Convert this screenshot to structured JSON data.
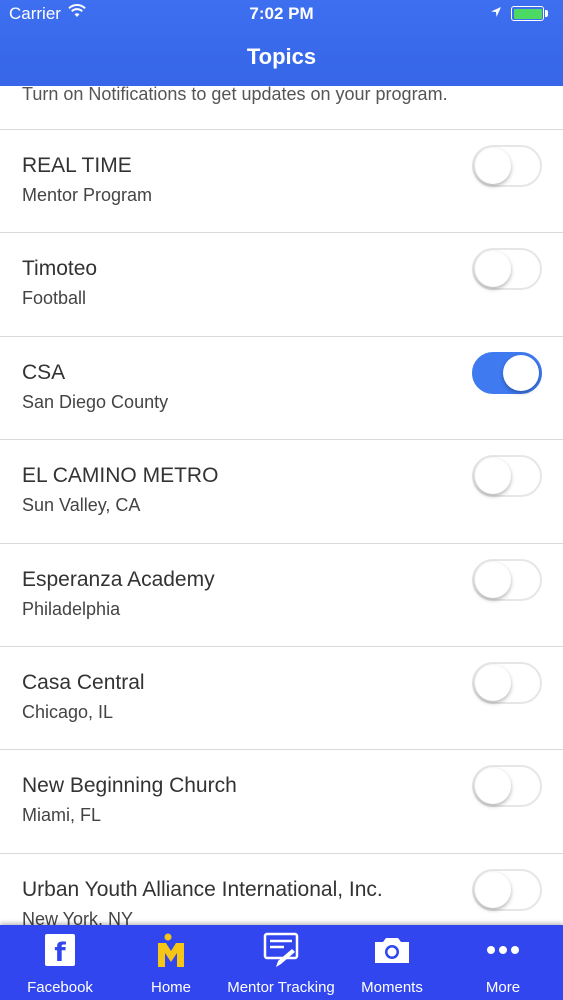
{
  "status_bar": {
    "carrier": "Carrier",
    "time": "7:02 PM",
    "icons": [
      "wifi-icon",
      "location-arrow-icon",
      "battery-icon"
    ],
    "battery_color": "#4cd964"
  },
  "header": {
    "title": "Topics",
    "color": "#3766e8"
  },
  "notice": "Turn on Notifications to get updates on your program.",
  "topics": [
    {
      "name": "REAL TIME",
      "place": "Mentor Program",
      "on": false
    },
    {
      "name": "Timoteo",
      "place": "Football",
      "on": false
    },
    {
      "name": "CSA",
      "place": "San Diego County",
      "on": true
    },
    {
      "name": "EL CAMINO METRO",
      "place": "Sun Valley, CA",
      "on": false
    },
    {
      "name": "Esperanza Academy",
      "place": "Philadelphia",
      "on": false
    },
    {
      "name": "Casa Central",
      "place": "Chicago, IL",
      "on": false
    },
    {
      "name": "New Beginning Church",
      "place": "Miami, FL",
      "on": false
    },
    {
      "name": "Urban Youth Alliance International, Inc.",
      "place": "New York, NY",
      "on": false
    }
  ],
  "toggle_on_color": "#3f7af0",
  "tabbar": {
    "color": "#3146ef",
    "tabs": [
      {
        "label": "Facebook",
        "icon": "facebook-icon"
      },
      {
        "label": "Home",
        "icon": "home-logo-icon"
      },
      {
        "label": "Mentor Tracking",
        "icon": "mentor-tracking-icon"
      },
      {
        "label": "Moments",
        "icon": "camera-icon"
      },
      {
        "label": "More",
        "icon": "more-dots-icon"
      }
    ]
  }
}
